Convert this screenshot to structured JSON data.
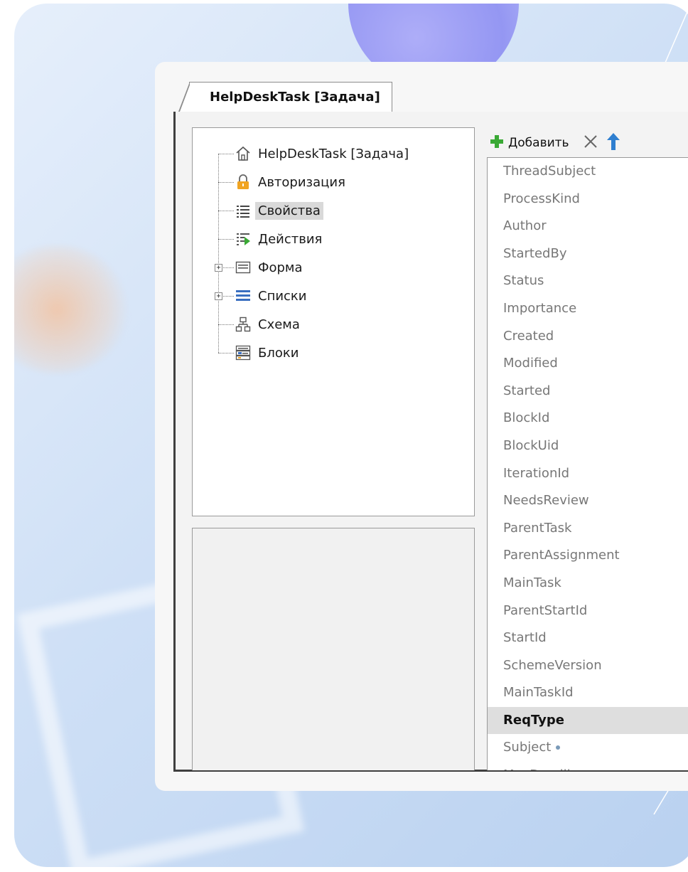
{
  "window": {
    "tab_label": "HelpDeskTask [Задача]"
  },
  "tree": {
    "items": [
      {
        "label": "HelpDeskTask [Задача]",
        "icon": "home-icon",
        "expandable": false,
        "selected": false
      },
      {
        "label": "Авторизация",
        "icon": "lock-icon",
        "expandable": false,
        "selected": false
      },
      {
        "label": "Свойства",
        "icon": "list-icon",
        "expandable": false,
        "selected": true
      },
      {
        "label": "Действия",
        "icon": "actions-icon",
        "expandable": false,
        "selected": false
      },
      {
        "label": "Форма",
        "icon": "form-icon",
        "expandable": true,
        "selected": false
      },
      {
        "label": "Списки",
        "icon": "lists-icon",
        "expandable": true,
        "selected": false
      },
      {
        "label": "Схема",
        "icon": "scheme-icon",
        "expandable": false,
        "selected": false
      },
      {
        "label": "Блоки",
        "icon": "blocks-icon",
        "expandable": false,
        "selected": false
      }
    ]
  },
  "toolbar": {
    "add_label": "Добавить",
    "add_icon": "plus-icon",
    "delete_icon": "close-icon",
    "move_up_icon": "arrow-up-icon"
  },
  "properties": {
    "items": [
      {
        "name": "ThreadSubject",
        "selected": false,
        "marked": false
      },
      {
        "name": "ProcessKind",
        "selected": false,
        "marked": false
      },
      {
        "name": "Author",
        "selected": false,
        "marked": false
      },
      {
        "name": "StartedBy",
        "selected": false,
        "marked": false
      },
      {
        "name": "Status",
        "selected": false,
        "marked": false
      },
      {
        "name": "Importance",
        "selected": false,
        "marked": false
      },
      {
        "name": "Created",
        "selected": false,
        "marked": false
      },
      {
        "name": "Modified",
        "selected": false,
        "marked": false
      },
      {
        "name": "Started",
        "selected": false,
        "marked": false
      },
      {
        "name": "BlockId",
        "selected": false,
        "marked": false
      },
      {
        "name": "BlockUid",
        "selected": false,
        "marked": false
      },
      {
        "name": "IterationId",
        "selected": false,
        "marked": false
      },
      {
        "name": "NeedsReview",
        "selected": false,
        "marked": false
      },
      {
        "name": "ParentTask",
        "selected": false,
        "marked": false
      },
      {
        "name": "ParentAssignment",
        "selected": false,
        "marked": false
      },
      {
        "name": "MainTask",
        "selected": false,
        "marked": false
      },
      {
        "name": "ParentStartId",
        "selected": false,
        "marked": false
      },
      {
        "name": "StartId",
        "selected": false,
        "marked": false
      },
      {
        "name": "SchemeVersion",
        "selected": false,
        "marked": false
      },
      {
        "name": "MainTaskId",
        "selected": false,
        "marked": false
      },
      {
        "name": "ReqType",
        "selected": true,
        "marked": false
      },
      {
        "name": "Subject",
        "selected": false,
        "marked": true
      },
      {
        "name": "MaxDeadline",
        "selected": false,
        "marked": true
      }
    ]
  },
  "colors": {
    "selection": "#d9d9d9",
    "add_green": "#3aa935",
    "up_blue": "#2f7fd0",
    "lock_orange": "#f0a422",
    "list_blue": "#3a6fc0",
    "dot": "#7a9ab8"
  }
}
